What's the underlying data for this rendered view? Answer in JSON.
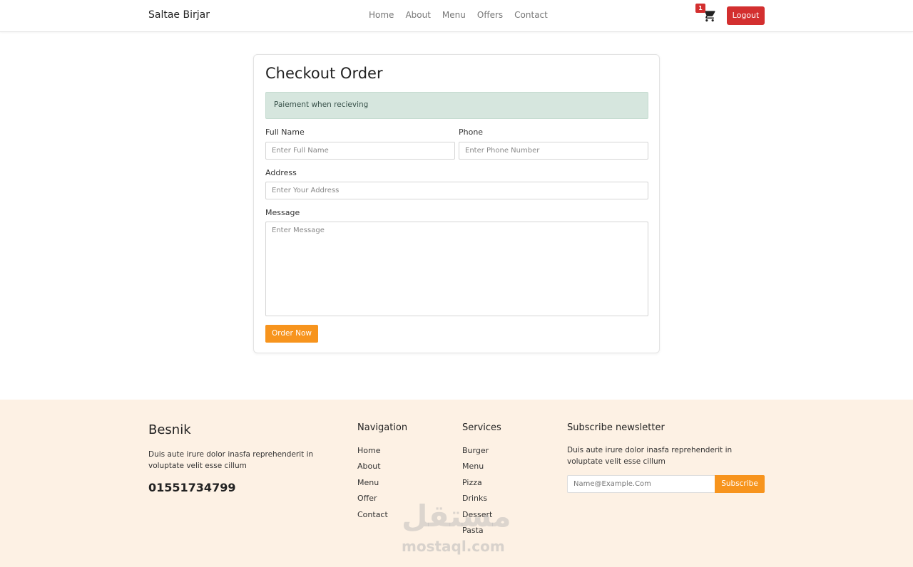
{
  "navbar": {
    "brand": "Saltae Birjar",
    "links": [
      "Home",
      "About",
      "Menu",
      "Offers",
      "Contact"
    ],
    "cart_count": "1",
    "logout_label": "Logout"
  },
  "checkout": {
    "title": "Checkout Order",
    "payment_notice": "Paiement when recieving",
    "full_name_label": "Full Name",
    "full_name_placeholder": "Enter Full Name",
    "phone_label": "Phone",
    "phone_placeholder": "Enter Phone Number",
    "address_label": "Address",
    "address_placeholder": "Enter Your Address",
    "message_label": "Message",
    "message_placeholder": "Enter Message",
    "order_button": "Order Now"
  },
  "footer": {
    "brand": "Besnik",
    "description": "Duis aute irure dolor inasfa reprehenderit in voluptate velit esse cillum",
    "phone": "01551734799",
    "navigation_title": "Navigation",
    "navigation_items": [
      "Home",
      "About",
      "Menu",
      "Offer",
      "Contact"
    ],
    "services_title": "Services",
    "services_items": [
      "Burger",
      "Menu",
      "Pizza",
      "Drinks",
      "Dessert",
      "Pasta"
    ],
    "newsletter_title": "Subscribe newsletter",
    "newsletter_description": "Duis aute irure dolor inasfa reprehenderit in voluptate velit esse cillum",
    "newsletter_placeholder": "Name@Example.Com",
    "subscribe_label": "Subscribe"
  },
  "watermark": {
    "arabic": "مستقل",
    "latin": "mostaql.com"
  },
  "colors": {
    "accent_orange": "#f7941d",
    "logout_red": "#d32f2f",
    "alert_green": "#d6e6de",
    "footer_bg": "#fdf1e4"
  },
  "icons": {
    "cart": "cart-icon"
  }
}
